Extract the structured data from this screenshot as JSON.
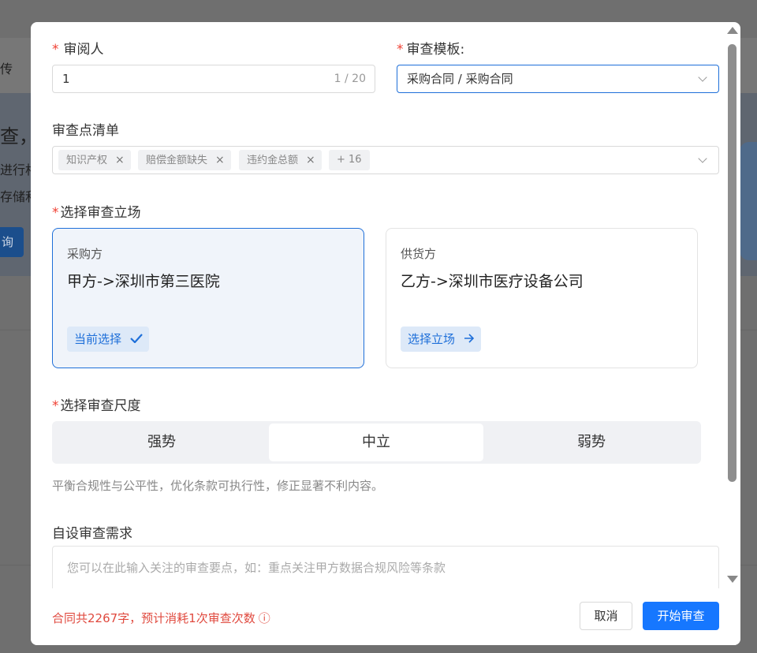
{
  "background": {
    "frag_nav": "传",
    "frag_title": "查，个",
    "frag_line1": "进行相",
    "frag_line2": "存储和",
    "frag_button": "询"
  },
  "form": {
    "reviewer": {
      "label": "审阅人",
      "value": "1",
      "counter": "1 / 20"
    },
    "template": {
      "label": "审查模板:",
      "value": "采购合同 / 采购合同"
    },
    "checklist": {
      "label": "审查点清单",
      "tags": [
        "知识产权",
        "赔偿金额缺失",
        "违约金总额"
      ],
      "more": "+ 16"
    },
    "stance": {
      "label": "选择审查立场",
      "cards": [
        {
          "role": "采购方",
          "party": "甲方->深圳市第三医院",
          "action": "当前选择",
          "icon": "check-icon",
          "selected": true
        },
        {
          "role": "供货方",
          "party": "乙方->深圳市医疗设备公司",
          "action": "选择立场",
          "icon": "arrow-right-icon",
          "selected": false
        }
      ]
    },
    "scale": {
      "label": "选择审查尺度",
      "options": [
        "强势",
        "中立",
        "弱势"
      ],
      "selected": "中立",
      "hint": "平衡合规性与公平性，优化条款可执行性，修正显著不利内容。"
    },
    "custom": {
      "label": "自设审查需求",
      "placeholder": "您可以在此输入关注的审查要点，如：重点关注甲方数据合规风险等条款"
    }
  },
  "footer": {
    "cost_text": "合同共2267字，预计消耗1次审查次数",
    "info_icon": "info-icon",
    "cancel_label": "取消",
    "start_label": "开始审查"
  },
  "colors": {
    "accent": "#1677ff",
    "required": "#f04134",
    "cost": "#e04a3f"
  }
}
